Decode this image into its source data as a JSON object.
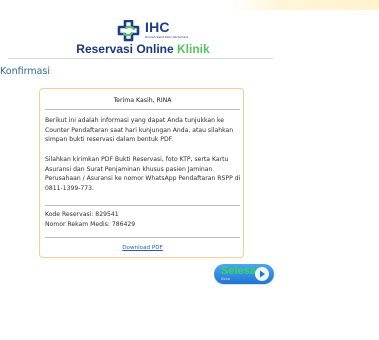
{
  "header": {
    "logo_text": "IHC",
    "logo_subtext": "Rumah Sakit Pelni Pertamina",
    "title_main": "Reservasi Online ",
    "title_accent": "Klinik"
  },
  "page": {
    "section_title": "Konfirmasi"
  },
  "card": {
    "thanks": "Terima Kasih, RINA",
    "paragraph_1": "Berikut ini adalah informasi yang dapat Anda tunjukkan ke Counter Pendaftaran saat hari kunjungan Anda, atau silahkan simpan bukti reservasi dalam bentuk PDF.",
    "paragraph_2": "Silahkan kirimkan PDF Bukti Reservasi, foto KTP, serta Kartu Asuransi dan Surat Penjaminan khusus pasien Jaminan Perusahaan / Asuransi ke nomor WhatsApp Pendaftaran RSPP di 0811-1399-773.",
    "reservation_code": "Kode Reservasi: 829541",
    "medical_record": "Nomor Rekam Medis: 786429",
    "download_label": "Download PDF"
  },
  "finish_button": {
    "label": "Selesai",
    "sublabel": "Done"
  },
  "colors": {
    "brand_blue": "#17377a",
    "brand_green": "#56c25f",
    "section_blue": "#2f6697",
    "card_border": "#f1cf96",
    "button_blue": "#1d76d3",
    "button_label_green": "#35d75a"
  },
  "icons": {
    "logo": "ihc-cross-logo-icon",
    "finish": "play-arrow-icon"
  }
}
